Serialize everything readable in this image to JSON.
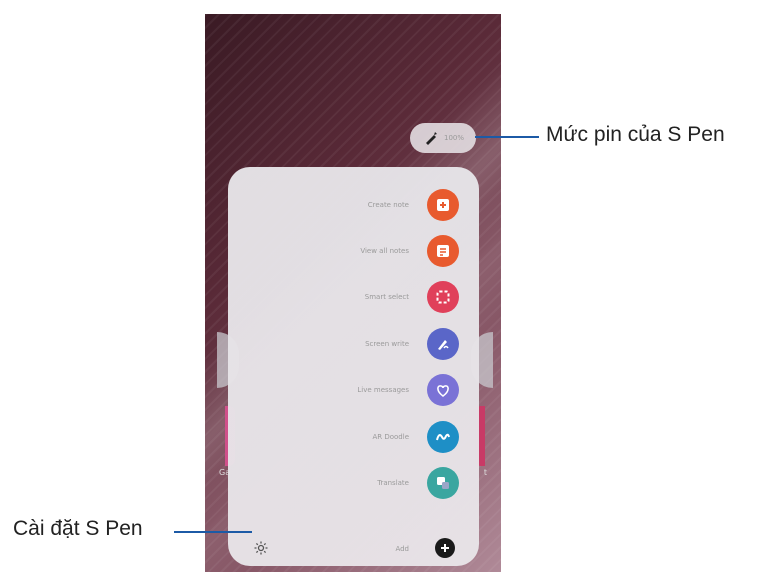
{
  "phone": {
    "battery": {
      "text": "100%"
    },
    "bottom_edge_left_label": "Ga",
    "bottom_edge_right_label": "t",
    "panel": {
      "items": [
        {
          "label": "Create note",
          "icon": "note-plus-icon",
          "color": "#e85a2e"
        },
        {
          "label": "View all notes",
          "icon": "notes-list-icon",
          "color": "#e85a2e"
        },
        {
          "label": "Smart select",
          "icon": "smart-select-icon",
          "color": "#e0405a"
        },
        {
          "label": "Screen write",
          "icon": "screen-write-icon",
          "color": "#5a66c8"
        },
        {
          "label": "Live messages",
          "icon": "heart-message-icon",
          "color": "#7a72d6"
        },
        {
          "label": "AR Doodle",
          "icon": "doodle-icon",
          "color": "#1e8fc6"
        },
        {
          "label": "Translate",
          "icon": "translate-icon",
          "color": "#3aa6a0"
        }
      ],
      "add_label": "Add",
      "settings_icon": "gear-icon",
      "add_icon": "plus-icon"
    }
  },
  "callouts": {
    "battery": "Mức pin của S Pen",
    "settings": "Cài đặt S Pen"
  },
  "colors": {
    "callout_line": "#1c5aa6"
  }
}
